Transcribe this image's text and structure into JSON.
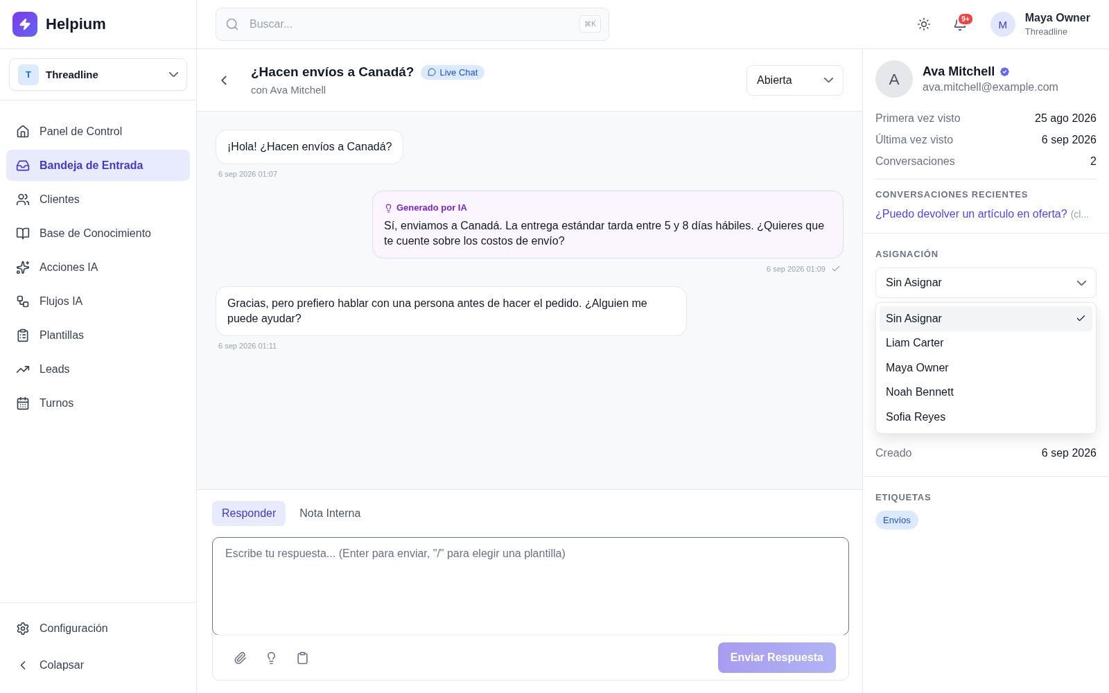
{
  "brand": {
    "name": "Helpium"
  },
  "workspace": {
    "initial": "T",
    "name": "Threadline"
  },
  "nav": [
    {
      "label": "Panel de Control",
      "selected": false
    },
    {
      "label": "Bandeja de Entrada",
      "selected": true
    },
    {
      "label": "Clientes",
      "selected": false
    },
    {
      "label": "Base de Conocimiento",
      "selected": false
    },
    {
      "label": "Acciones IA",
      "selected": false
    },
    {
      "label": "Flujos IA",
      "selected": false
    },
    {
      "label": "Plantillas",
      "selected": false
    },
    {
      "label": "Leads",
      "selected": false
    },
    {
      "label": "Turnos",
      "selected": false
    }
  ],
  "sidebar_footer": [
    {
      "label": "Configuración"
    },
    {
      "label": "Colapsar"
    }
  ],
  "search": {
    "placeholder": "Buscar...",
    "shortcut": "⌘K"
  },
  "notifications": {
    "badge": "9+"
  },
  "user": {
    "initial": "M",
    "name": "Maya Owner",
    "org": "Threadline"
  },
  "conversation": {
    "title": "¿Hacen envíos a Canadá?",
    "channel": "Live Chat",
    "subtitle": "con Ava Mitchell",
    "status": "Abierta"
  },
  "messages": [
    {
      "kind": "customer",
      "text": "¡Hola! ¿Hacen envíos a Canadá?",
      "time": "6 sep 2026 01:07"
    },
    {
      "kind": "ai",
      "label": "Generado por IA",
      "text": "Sí, enviamos a Canadá. La entrega estándar tarda entre 5 y 8 días hábiles. ¿Quieres que te cuente sobre los costos de envío?",
      "time": "6 sep 2026 01:09",
      "delivered": true
    },
    {
      "kind": "customer",
      "text": "Gracias, pero prefiero hablar con una persona antes de hacer el pedido. ¿Alguien me puede ayudar?",
      "time": "6 sep 2026 01:11"
    }
  ],
  "composer": {
    "tabs": [
      {
        "label": "Responder",
        "selected": true
      },
      {
        "label": "Nota Interna",
        "selected": false
      }
    ],
    "placeholder": "Escribe tu respuesta... (Enter para enviar, \"/\" para elegir una plantilla)",
    "send_button": "Enviar Respuesta",
    "send_disabled": true
  },
  "contact": {
    "initial": "A",
    "name": "Ava Mitchell",
    "verified": true,
    "email": "ava.mitchell@example.com",
    "stats": [
      {
        "label": "Primera vez visto",
        "value": "25 ago 2026"
      },
      {
        "label": "Última vez visto",
        "value": "6 sep 2026"
      },
      {
        "label": "Conversaciones",
        "value": "2"
      }
    ],
    "recent_heading": "CONVERSACIONES RECIENTES",
    "recent": [
      {
        "title": "¿Puedo devolver un artículo en oferta?",
        "note": "(cl..."
      }
    ]
  },
  "assignment": {
    "heading": "ASIGNACIÓN",
    "value": "Sin Asignar",
    "options": [
      {
        "label": "Sin Asignar",
        "selected": true
      },
      {
        "label": "Liam Carter",
        "selected": false
      },
      {
        "label": "Maya Owner",
        "selected": false
      },
      {
        "label": "Noah Bennett",
        "selected": false
      },
      {
        "label": "Sofia Reyes",
        "selected": false
      }
    ]
  },
  "details": [
    {
      "label": "Creado",
      "value": "6 sep 2026"
    }
  ],
  "tags": {
    "heading": "ETIQUETAS",
    "items": [
      {
        "label": "Envíos"
      }
    ]
  }
}
